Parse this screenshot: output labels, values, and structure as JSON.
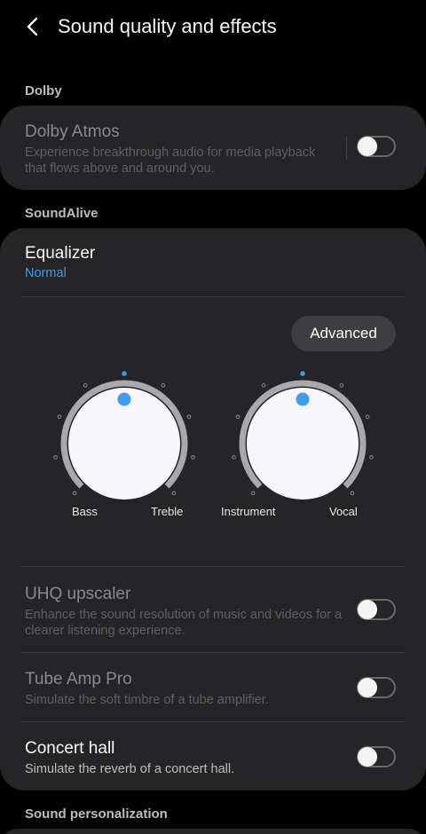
{
  "header": {
    "title": "Sound quality and effects",
    "back_icon": "chevron-left-icon"
  },
  "sections": {
    "dolby": "Dolby",
    "soundalive": "SoundAlive",
    "personalization": "Sound personalization"
  },
  "dolby_atmos": {
    "title": "Dolby Atmos",
    "subtitle": "Experience breakthrough audio for media playback that flows above and around you.",
    "enabled": false
  },
  "equalizer": {
    "title": "Equalizer",
    "value": "Normal",
    "advanced_label": "Advanced",
    "dial1": {
      "left_label": "Bass",
      "right_label": "Treble",
      "level": 0.5
    },
    "dial2": {
      "left_label": "Instrument",
      "right_label": "Vocal",
      "level": 0.5
    }
  },
  "uhq": {
    "title": "UHQ upscaler",
    "subtitle": "Enhance the sound resolution of music and videos for a clearer listening experience.",
    "enabled": false
  },
  "tube_amp": {
    "title": "Tube Amp Pro",
    "subtitle": "Simulate the soft timbre of a tube amplifier.",
    "enabled": false
  },
  "concert_hall": {
    "title": "Concert hall",
    "subtitle": "Simulate the reverb of a concert hall.",
    "enabled": false
  },
  "colors": {
    "accent": "#3e9cf0",
    "card": "#252527",
    "background": "#000000"
  }
}
